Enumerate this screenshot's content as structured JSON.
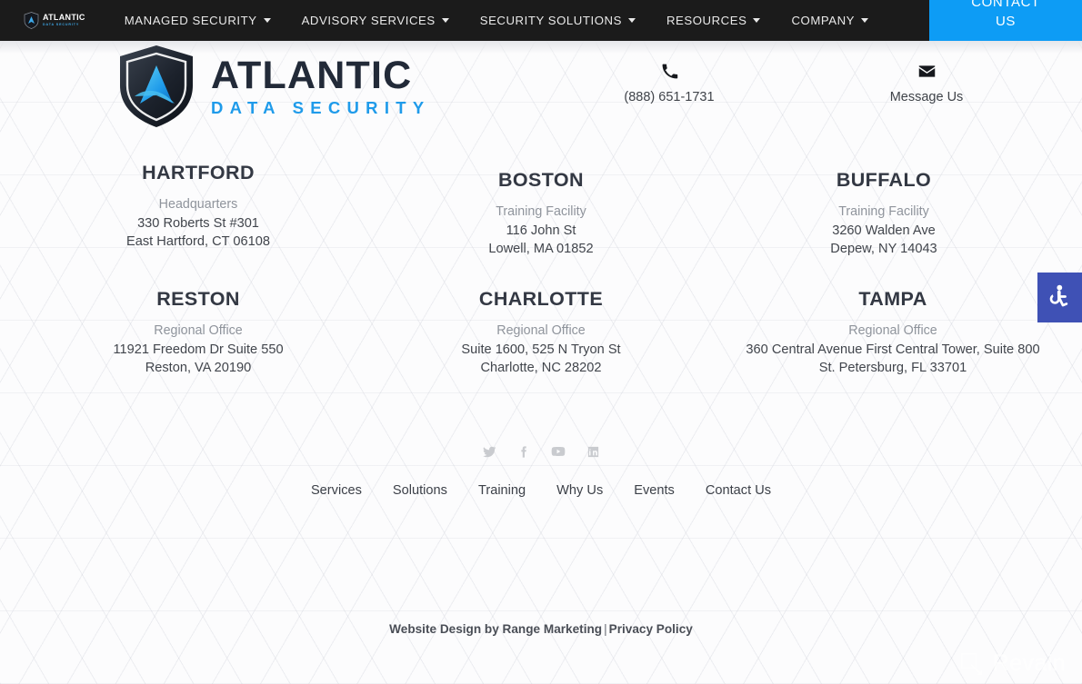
{
  "topnav": {
    "logo": {
      "name": "Atlantic Data Security",
      "top": "ATLANTIC",
      "bottom": "DATA SECURITY"
    },
    "items": [
      {
        "label": "MANAGED SECURITY",
        "has_dropdown": true
      },
      {
        "label": "ADVISORY SERVICES",
        "has_dropdown": true
      },
      {
        "label": "SECURITY SOLUTIONS",
        "has_dropdown": true
      },
      {
        "label": "RESOURCES",
        "has_dropdown": true
      },
      {
        "label": "COMPANY",
        "has_dropdown": true
      }
    ],
    "cta": {
      "line1": "CONTACT",
      "line2": "US",
      "color": "#0d9cf5"
    }
  },
  "brand": {
    "logo_top": "ATLANTIC",
    "logo_bottom": "DATA SECURITY",
    "logo_top_color": "#222a38",
    "logo_bottom_color": "#1f9bea"
  },
  "contact": {
    "phone": {
      "icon": "phone-icon",
      "label": "(888) 651-1731"
    },
    "email": {
      "icon": "envelope-icon",
      "label": "Message Us"
    }
  },
  "offices": [
    {
      "id": "hartford",
      "city": "HARTFORD",
      "kind": "Headquarters",
      "line1": "330 Roberts St #301",
      "line2": "East Hartford, CT 06108"
    },
    {
      "id": "boston",
      "city": "BOSTON",
      "kind": "Training Facility",
      "line1": "116 John St",
      "line2": "Lowell, MA 01852"
    },
    {
      "id": "buffalo",
      "city": "BUFFALO",
      "kind": "Training Facility",
      "line1": "3260 Walden Ave",
      "line2": "Depew, NY 14043"
    },
    {
      "id": "reston",
      "city": "RESTON",
      "kind": "Regional Office",
      "line1": "11921 Freedom Dr Suite 550",
      "line2": "Reston, VA 20190"
    },
    {
      "id": "charlotte",
      "city": "CHARLOTTE",
      "kind": "Regional Office",
      "line1": "Suite 1600, 525 N Tryon St",
      "line2": "Charlotte, NC 28202"
    },
    {
      "id": "tampa",
      "city": "TAMPA",
      "kind": "Regional Office",
      "line1": "360 Central Avenue First Central Tower, Suite 800",
      "line2": "St. Petersburg, FL 33701"
    }
  ],
  "social": [
    {
      "icon": "twitter-icon",
      "label": "Twitter"
    },
    {
      "icon": "facebook-icon",
      "label": "Facebook"
    },
    {
      "icon": "youtube-icon",
      "label": "YouTube"
    },
    {
      "icon": "linkedin-icon",
      "label": "LinkedIn"
    }
  ],
  "footer_links": [
    {
      "label": "Services"
    },
    {
      "label": "Solutions"
    },
    {
      "label": "Training"
    },
    {
      "label": "Why Us"
    },
    {
      "label": "Events"
    },
    {
      "label": "Contact Us"
    }
  ],
  "credit": {
    "design": "Website Design by Range Marketing",
    "separator": "|",
    "privacy": "Privacy Policy"
  },
  "accessibility": {
    "icon": "wheelchair-icon",
    "color": "#3f51b5"
  },
  "watermark": {
    "text": "Revain",
    "icon": "revain-logo-icon"
  }
}
